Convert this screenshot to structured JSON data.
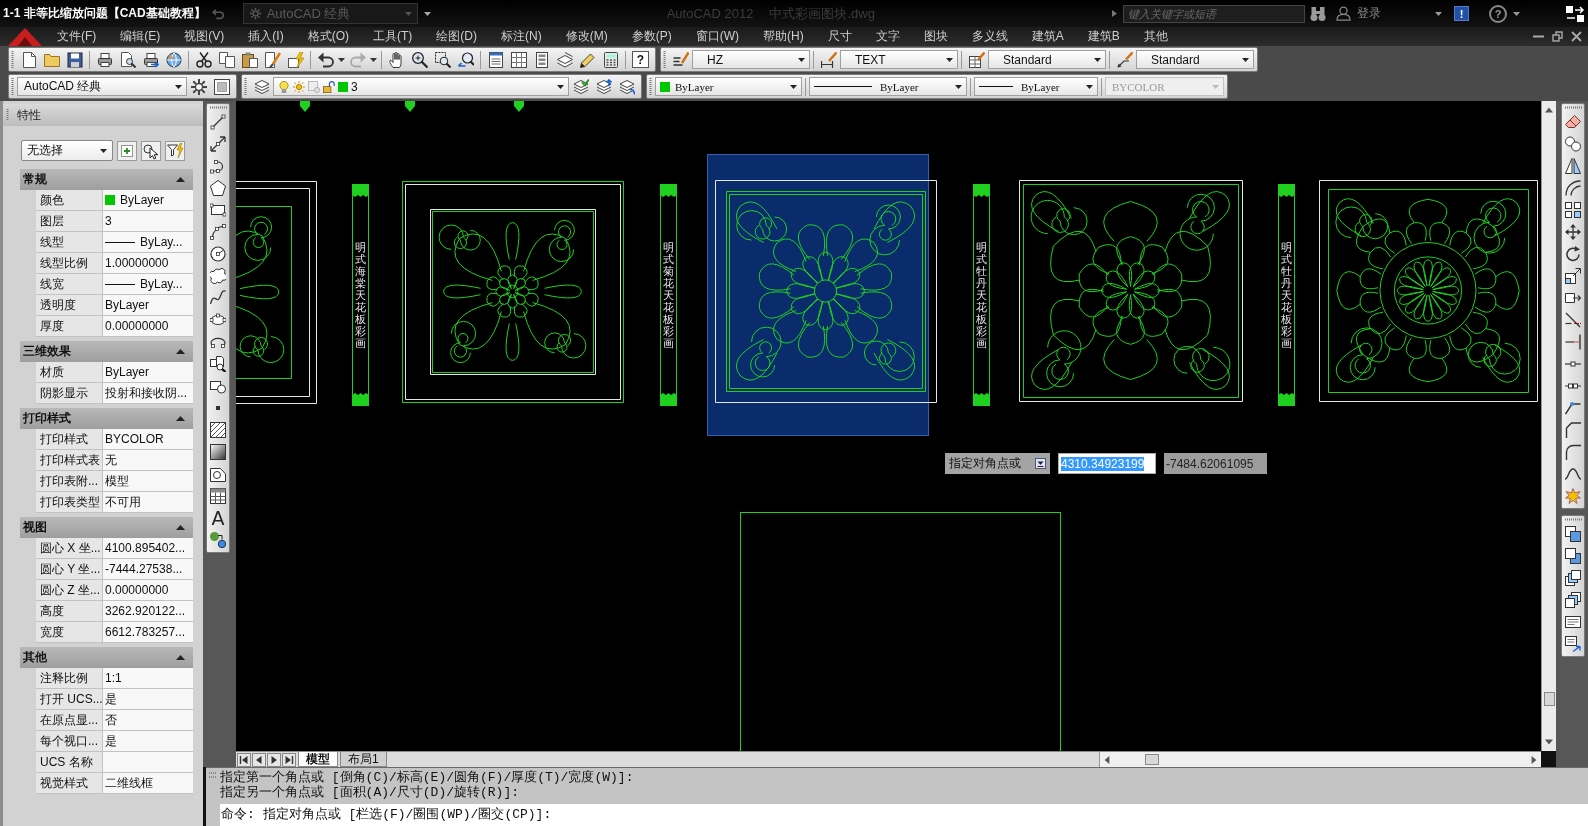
{
  "title_bar": {
    "caption": "1-1 非等比缩放问题【CAD基础教程】",
    "workspace": "AutoCAD 经典",
    "app_name": "AutoCAD 2012",
    "file_name": "中式彩画图块.dwg",
    "search": {
      "placeholder": "键入关键字或短语"
    },
    "sign_in": "登录",
    "exchange_glyph": "!",
    "help_glyph": "?"
  },
  "menu_bar": {
    "items": [
      "文件(F)",
      "编辑(E)",
      "视图(V)",
      "插入(I)",
      "格式(O)",
      "工具(T)",
      "绘图(D)",
      "标注(N)",
      "修改(M)",
      "参数(P)",
      "窗口(W)",
      "帮助(H)",
      "尺寸",
      "文字",
      "图块",
      "多义线",
      "建筑A",
      "建筑B",
      "其他"
    ]
  },
  "standard_toolbar": {
    "help_glyph": "?"
  },
  "styles_toolbar": {
    "text_style": "HZ",
    "dimension_style": "TEXT",
    "table_style": "Standard",
    "multileader_style": "Standard"
  },
  "workspaces_toolbar": {
    "workspace": "AutoCAD 经典"
  },
  "layers_toolbar": {
    "layer": {
      "name": "3",
      "color": "#00c800"
    }
  },
  "properties_toolbar": {
    "color": {
      "label": "ByLayer",
      "color": "#00c800"
    },
    "linetype": "ByLayer",
    "lineweight": "ByLayer",
    "plot_style": {
      "label": "BYCOLOR",
      "disabled": true
    }
  },
  "properties_palette": {
    "title": "特性",
    "selection": "无选择",
    "sections": [
      {
        "title": "常规",
        "expanded": true,
        "rows": [
          {
            "label": "颜色",
            "value": "ByLayer",
            "kind": "color",
            "color": "#00c800"
          },
          {
            "label": "图层",
            "value": "3",
            "kind": "text"
          },
          {
            "label": "线型",
            "value": "ByLay...",
            "kind": "line"
          },
          {
            "label": "线型比例",
            "value": "1.00000000",
            "kind": "text"
          },
          {
            "label": "线宽",
            "value": "ByLay...",
            "kind": "line"
          },
          {
            "label": "透明度",
            "value": "ByLayer",
            "kind": "text"
          },
          {
            "label": "厚度",
            "value": "0.00000000",
            "kind": "text"
          }
        ]
      },
      {
        "title": "三维效果",
        "expanded": true,
        "rows": [
          {
            "label": "材质",
            "value": "ByLayer",
            "kind": "text"
          },
          {
            "label": "阴影显示",
            "value": "投射和接收阴...",
            "kind": "text"
          }
        ]
      },
      {
        "title": "打印样式",
        "expanded": true,
        "rows": [
          {
            "label": "打印样式",
            "value": "BYCOLOR",
            "kind": "text"
          },
          {
            "label": "打印样式表",
            "value": "无",
            "kind": "text"
          },
          {
            "label": "打印表附...",
            "value": "模型",
            "kind": "text"
          },
          {
            "label": "打印表类型",
            "value": "不可用",
            "kind": "text"
          }
        ]
      },
      {
        "title": "视图",
        "expanded": true,
        "rows": [
          {
            "label": "圆心 X 坐...",
            "value": "4100.895402...",
            "kind": "text"
          },
          {
            "label": "圆心 Y 坐...",
            "value": "-7444.27538...",
            "kind": "text"
          },
          {
            "label": "圆心 Z 坐...",
            "value": "0.00000000",
            "kind": "text"
          },
          {
            "label": "高度",
            "value": "3262.920122...",
            "kind": "text"
          },
          {
            "label": "宽度",
            "value": "6612.783257...",
            "kind": "text"
          }
        ]
      },
      {
        "title": "其他",
        "expanded": true,
        "rows": [
          {
            "label": "注释比例",
            "value": "1:1",
            "kind": "text"
          },
          {
            "label": "打开 UCS...",
            "value": "是",
            "kind": "text"
          },
          {
            "label": "在原点显...",
            "value": "否",
            "kind": "text"
          },
          {
            "label": "每个视口...",
            "value": "是",
            "kind": "text"
          },
          {
            "label": "UCS 名称",
            "kind": "text"
          },
          {
            "label": "视觉样式",
            "value": "二维线框",
            "kind": "text"
          }
        ]
      }
    ]
  },
  "draw_toolbar": {
    "text_glyph": "A"
  },
  "drawing": {
    "panels": [
      {
        "selected": false
      },
      {
        "selected": false
      },
      {
        "selected": true
      },
      {
        "selected": false
      },
      {
        "selected": false
      }
    ],
    "labels": [
      "明式海棠天花板彩画",
      "明式菊花天花板彩画",
      "明式牡丹天花板彩画",
      "明式牡丹天花板彩画"
    ],
    "dynamic_input": {
      "prompt": "指定对角点或",
      "x_value": "4310.34923199",
      "y_value": "-7484.62061095"
    }
  },
  "layout_tabs": [
    {
      "label": "模型",
      "selected": true
    },
    {
      "label": "布局1",
      "selected": false
    }
  ],
  "command_line": {
    "history": [
      "指定第一个角点或 [倒角(C)/标高(E)/圆角(F)/厚度(T)/宽度(W)]:",
      "指定另一个角点或 [面积(A)/尺寸(D)/旋转(R)]:"
    ],
    "prompt": "命令: 指定对角点或 [栏选(F)/圈围(WP)/圈交(CP)]:"
  }
}
